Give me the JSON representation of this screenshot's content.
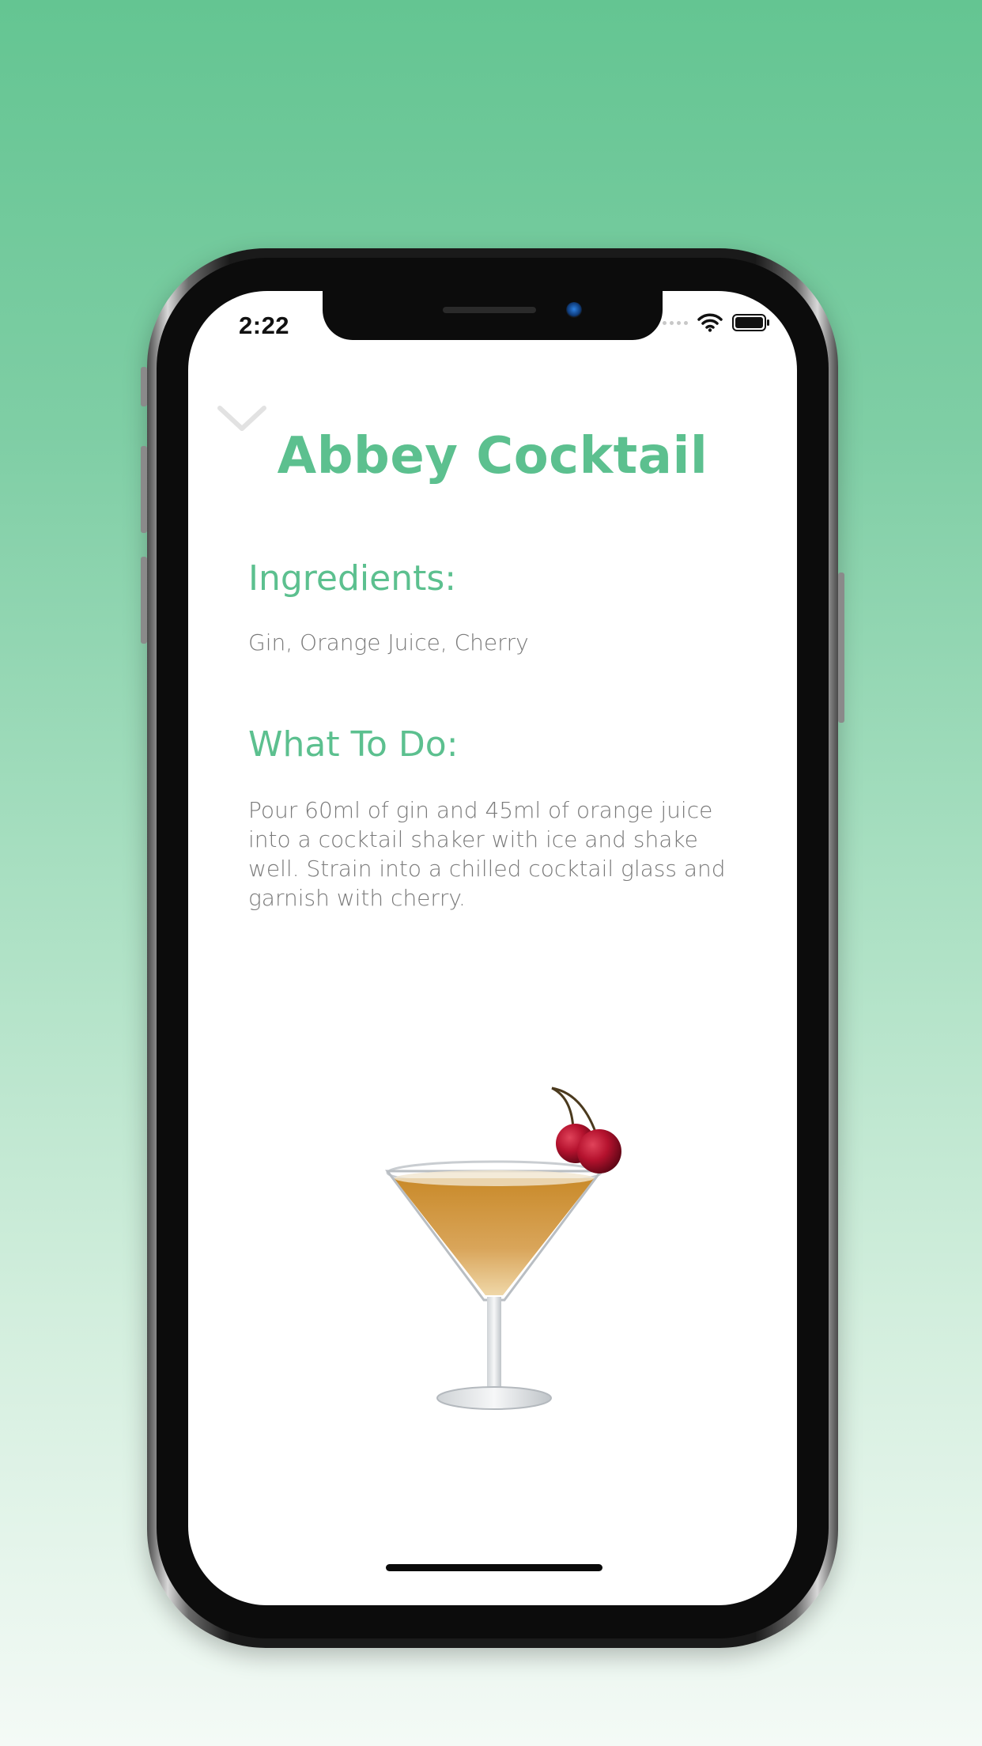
{
  "status_bar": {
    "time": "2:22"
  },
  "drink": {
    "title": "Abbey Cocktail",
    "ingredients_heading": "Ingredients:",
    "ingredients": "Gin, Orange Juice, Cherry",
    "instructions_heading": "What To Do:",
    "instructions": "Pour 60ml of gin and 45ml of orange juice into a cocktail shaker with ice and shake well. Strain into a chilled cocktail glass and garnish with cherry."
  },
  "icons": {
    "dismiss": "chevron-down-icon",
    "wifi": "wifi-icon",
    "battery": "battery-icon",
    "signal": "signal-dots-icon"
  },
  "colors": {
    "accent": "#5cc08f",
    "background_top": "#64c592",
    "background_bottom": "#f4faf6",
    "body_text": "#7a7a7a"
  }
}
